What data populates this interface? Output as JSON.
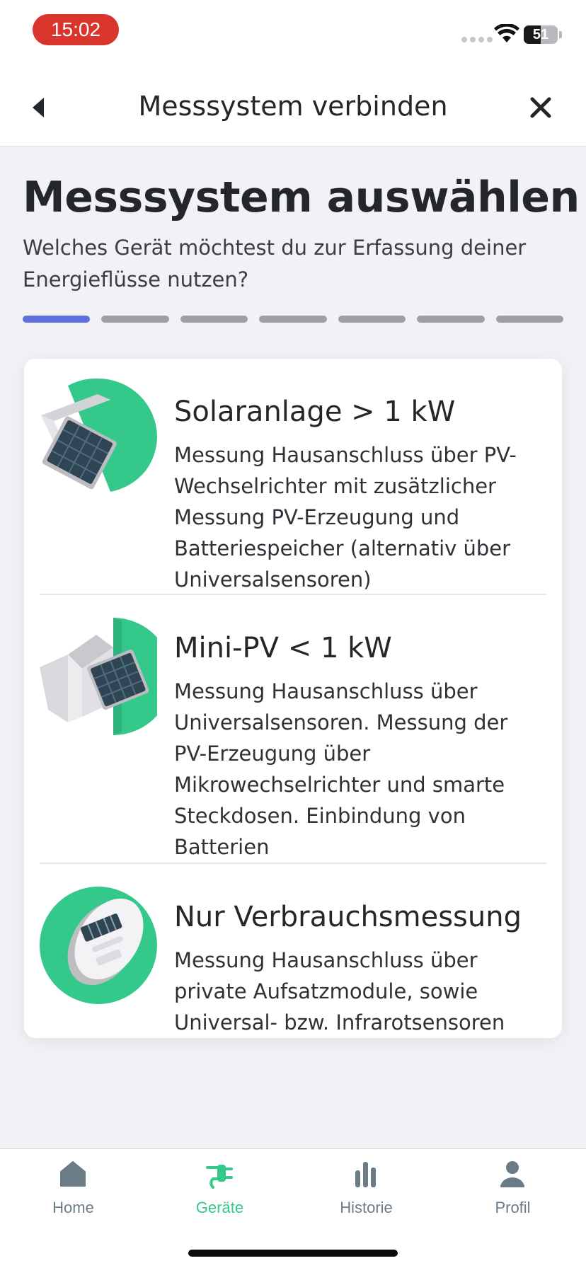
{
  "status_bar": {
    "time": "15:02",
    "battery_level": "51",
    "battery_fraction": 0.51
  },
  "header": {
    "title": "Messsystem verbinden",
    "back_icon": "chevron-left-icon",
    "close_icon": "close-icon"
  },
  "page": {
    "title": "Messsystem auswählen",
    "subtitle": "Welches Gerät möchtest du zur Erfassung deiner Energieflüsse nutzen?",
    "progress": {
      "current_step": 1,
      "total_steps": 7
    }
  },
  "options": [
    {
      "title": "Solaranlage > 1 kW",
      "description": "Messung Hausanschluss über PV-Wechselrichter mit zusätzlicher Messung PV-Erzeugung und Batteriespeicher (alternativ über Universalsensoren)",
      "icon": "solar-panel-icon"
    },
    {
      "title": "Mini-PV < 1 kW",
      "description": "Messung Hausanschluss über Universalsensoren. Messung der PV-Erzeugung über Mikrowechselrichter und smarte Steckdosen. Einbindung von Batterien",
      "icon": "balcony-solar-icon"
    },
    {
      "title": "Nur Verbrauchsmessung",
      "description": "Messung Hausanschluss über private Aufsatzmodule, sowie Universal- bzw. Infrarotsensoren",
      "icon": "electricity-meter-icon"
    }
  ],
  "tab_bar": {
    "tabs": [
      {
        "label": "Home",
        "icon": "home-icon",
        "active": false
      },
      {
        "label": "Geräte",
        "icon": "plug-icon",
        "active": true
      },
      {
        "label": "Historie",
        "icon": "bar-chart-icon",
        "active": false
      },
      {
        "label": "Profil",
        "icon": "person-icon",
        "active": false
      }
    ]
  },
  "colors": {
    "accent_green": "#34c98b",
    "progress_active": "#5c6fdc",
    "progress_inactive": "#9e9ea3",
    "time_pill": "#d9352c",
    "tab_inactive": "#6b7c87"
  }
}
